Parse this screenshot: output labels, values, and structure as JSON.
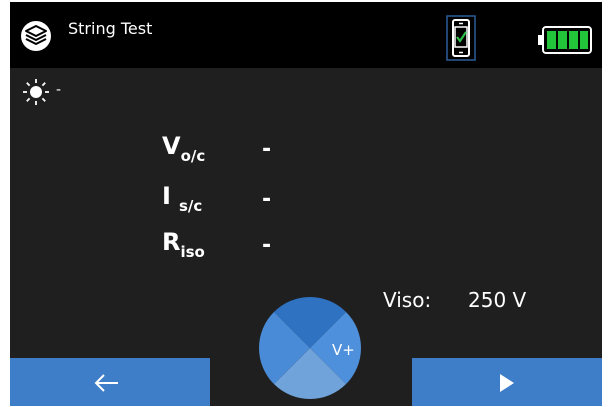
{
  "header": {
    "title": "String Test",
    "logo_icon": "app-logo-icon",
    "phone_status_icon": "phone-connected-icon",
    "battery_icon": "battery-full-icon"
  },
  "irradiance": {
    "icon": "sun-icon",
    "value": "-"
  },
  "measurements": [
    {
      "name": "V",
      "subscript": "o/c",
      "value": "-"
    },
    {
      "name": "I",
      "subscript": "s/c",
      "value": "-"
    },
    {
      "name": "R",
      "subscript": "iso",
      "value": "-"
    }
  ],
  "viso": {
    "label": "Viso:",
    "value": "250 V"
  },
  "test_button": {
    "label": "V+"
  },
  "footer": {
    "back_icon": "arrow-left-icon",
    "next_icon": "play-icon"
  },
  "colors": {
    "background": "#1f1f1f",
    "topbar": "#000000",
    "accent_blue": "#3e7dc8",
    "check_green": "#2fbf4a",
    "battery_green": "#22c53a"
  }
}
